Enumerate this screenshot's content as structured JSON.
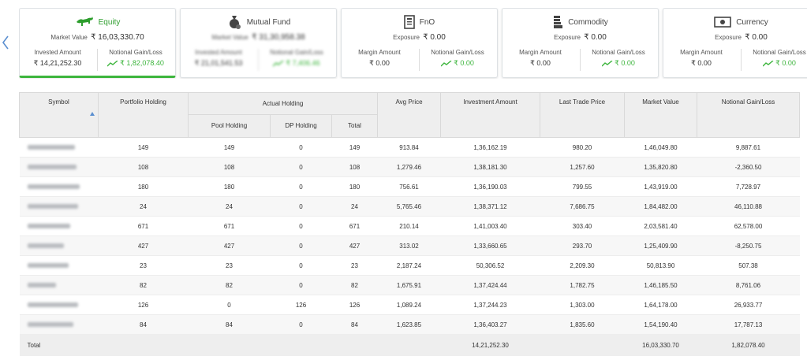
{
  "summary_cards": [
    {
      "name": "Equity",
      "active": true,
      "main_label": "Market Value",
      "main_value": "₹ 16,03,330.70",
      "left_label": "Invested Amount",
      "left_value": "₹ 14,21,252.30",
      "right_label": "Notional Gain/Loss",
      "right_value": "₹ 1,82,078.40",
      "icon": "bull-icon",
      "blurred": false
    },
    {
      "name": "Mutual Fund",
      "active": false,
      "main_label": "Market Value",
      "main_value": "₹ 31,30,958.38",
      "left_label": "Invested Amount",
      "left_value": "₹ 21,01,541.53",
      "right_label": "Notional Gain/Loss",
      "right_value": "₹ 7,406.46",
      "icon": "money-bag-icon",
      "blurred": true
    },
    {
      "name": "FnO",
      "active": false,
      "main_label": "Exposure",
      "main_value": "₹ 0.00",
      "left_label": "Margin Amount",
      "left_value": "₹ 0.00",
      "right_label": "Notional Gain/Loss",
      "right_value": "₹ 0.00",
      "icon": "document-icon",
      "blurred": false
    },
    {
      "name": "Commodity",
      "active": false,
      "main_label": "Exposure",
      "main_value": "₹ 0.00",
      "left_label": "Margin Amount",
      "left_value": "₹ 0.00",
      "right_label": "Notional Gain/Loss",
      "right_value": "₹ 0.00",
      "icon": "commodity-stack-icon",
      "blurred": false
    },
    {
      "name": "Currency",
      "active": false,
      "main_label": "Exposure",
      "main_value": "₹ 0.00",
      "left_label": "Margin Amount",
      "left_value": "₹ 0.00",
      "right_label": "Notional Gain/Loss",
      "right_value": "₹ 0.00",
      "icon": "currency-note-icon",
      "blurred": false
    }
  ],
  "table": {
    "headers": {
      "symbol": "Symbol",
      "portfolio_holding": "Portfolio Holding",
      "actual_holding": "Actual Holding",
      "pool_holding": "Pool Holding",
      "dp_holding": "DP Holding",
      "total": "Total",
      "avg_price": "Avg Price",
      "investment_amount": "Investment Amount",
      "last_trade_price": "Last Trade Price",
      "market_value": "Market Value",
      "notional_gain_loss": "Notional Gain/Loss"
    },
    "rows": [
      {
        "portfolio": "149",
        "pool": "149",
        "dp": "0",
        "total": "149",
        "avg": "913.84",
        "invest": "1,36,162.19",
        "ltp": "980.20",
        "mv": "1,46,049.80",
        "gain": "9,887.61"
      },
      {
        "portfolio": "108",
        "pool": "108",
        "dp": "0",
        "total": "108",
        "avg": "1,279.46",
        "invest": "1,38,181.30",
        "ltp": "1,257.60",
        "mv": "1,35,820.80",
        "gain": "-2,360.50"
      },
      {
        "portfolio": "180",
        "pool": "180",
        "dp": "0",
        "total": "180",
        "avg": "756.61",
        "invest": "1,36,190.03",
        "ltp": "799.55",
        "mv": "1,43,919.00",
        "gain": "7,728.97"
      },
      {
        "portfolio": "24",
        "pool": "24",
        "dp": "0",
        "total": "24",
        "avg": "5,765.46",
        "invest": "1,38,371.12",
        "ltp": "7,686.75",
        "mv": "1,84,482.00",
        "gain": "46,110.88"
      },
      {
        "portfolio": "671",
        "pool": "671",
        "dp": "0",
        "total": "671",
        "avg": "210.14",
        "invest": "1,41,003.40",
        "ltp": "303.40",
        "mv": "2,03,581.40",
        "gain": "62,578.00"
      },
      {
        "portfolio": "427",
        "pool": "427",
        "dp": "0",
        "total": "427",
        "avg": "313.02",
        "invest": "1,33,660.65",
        "ltp": "293.70",
        "mv": "1,25,409.90",
        "gain": "-8,250.75"
      },
      {
        "portfolio": "23",
        "pool": "23",
        "dp": "0",
        "total": "23",
        "avg": "2,187.24",
        "invest": "50,306.52",
        "ltp": "2,209.30",
        "mv": "50,813.90",
        "gain": "507.38"
      },
      {
        "portfolio": "82",
        "pool": "82",
        "dp": "0",
        "total": "82",
        "avg": "1,675.91",
        "invest": "1,37,424.44",
        "ltp": "1,782.75",
        "mv": "1,46,185.50",
        "gain": "8,761.06"
      },
      {
        "portfolio": "126",
        "pool": "0",
        "dp": "126",
        "total": "126",
        "avg": "1,089.24",
        "invest": "1,37,244.23",
        "ltp": "1,303.00",
        "mv": "1,64,178.00",
        "gain": "26,933.77"
      },
      {
        "portfolio": "84",
        "pool": "84",
        "dp": "0",
        "total": "84",
        "avg": "1,623.85",
        "invest": "1,36,403.27",
        "ltp": "1,835.60",
        "mv": "1,54,190.40",
        "gain": "17,787.13"
      }
    ],
    "footer": {
      "label": "Total",
      "invest": "14,21,252.30",
      "mv": "16,03,330.70",
      "gain": "1,82,078.40"
    }
  },
  "colors": {
    "accent_green": "#3db53d",
    "header_bg": "#eeeeee",
    "nav_arrow": "#5b8fd0"
  }
}
